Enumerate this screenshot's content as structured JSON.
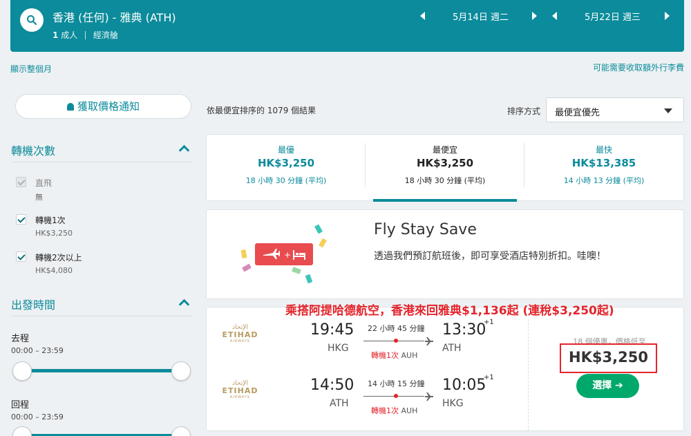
{
  "header": {
    "route": "香港 (任何) - 雅典 (ATH)",
    "pax_count": "1",
    "pax_suffix": "成人",
    "cabin": "經濟艙",
    "depart_date": "5月14日 週二",
    "return_date": "5月22日 週三"
  },
  "links": {
    "show_month": "顯示整個月",
    "baggage_fees": "可能需要收取額外行李費"
  },
  "sidebar": {
    "alert_button": "獲取價格通知",
    "stops": {
      "title": "轉機次數",
      "options": [
        {
          "label": "直飛",
          "sub": "無",
          "checked": true,
          "disabled": true
        },
        {
          "label": "轉機1次",
          "sub": "HK$3,250",
          "checked": true,
          "disabled": false
        },
        {
          "label": "轉機2次以上",
          "sub": "HK$4,080",
          "checked": true,
          "disabled": false
        }
      ]
    },
    "times": {
      "title": "出發時間",
      "outbound_label": "去程",
      "outbound_range": "00:00 – 23:59",
      "return_label": "回程",
      "return_range": "00:00 – 23:59"
    }
  },
  "results": {
    "count_text": "依最便宜排序的 1079 個結果",
    "sort_label": "排序方式",
    "sort_value": "最便宜優先",
    "tabs": [
      {
        "name": "最優",
        "price": "HK$3,250",
        "duration": "18 小時 30 分鐘 (平均)"
      },
      {
        "name": "最便宜",
        "price": "HK$3,250",
        "duration": "18 小時 30 分鐘 (平均)"
      },
      {
        "name": "最快",
        "price": "HK$13,385",
        "duration": "14 小時 13 分鐘 (平均)"
      }
    ]
  },
  "promo": {
    "title": "Fly Stay Save",
    "description": "透過我們預訂航班後，即可享受酒店特別折扣。哇噢！"
  },
  "annotation": "乘搭阿提哈德航空，香港來回雅典$1,136起 (連稅$3,250起)",
  "card": {
    "airline_ar": "الإتحاد",
    "airline_en": "ETIHAD",
    "airline_sub": "AIRWAYS",
    "outbound": {
      "dep_time": "19:45",
      "dep_code": "HKG",
      "duration": "22 小時 45 分鐘",
      "stop_count": "轉機1次",
      "stop_airport": "AUH",
      "arr_time": "13:30",
      "arr_offset": "+1",
      "arr_code": "ATH"
    },
    "inbound": {
      "dep_time": "14:50",
      "dep_code": "ATH",
      "duration": "14 小時 15 分鐘",
      "stop_count": "轉機1次",
      "stop_airport": "AUH",
      "arr_time": "10:05",
      "arr_offset": "+1",
      "arr_code": "HKG"
    },
    "deals_text": "18 個優惠，價格低至",
    "price": "HK$3,250",
    "select_label": "選擇 ➔"
  }
}
